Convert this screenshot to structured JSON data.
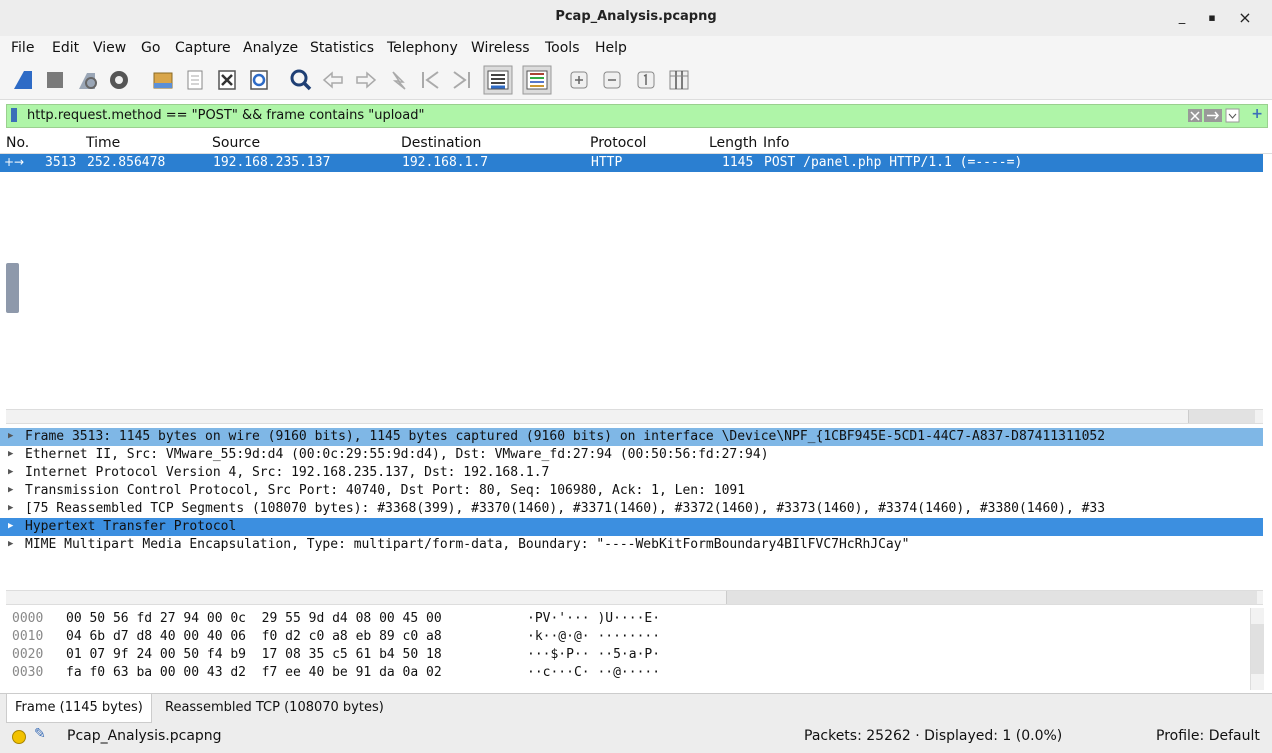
{
  "window": {
    "title": "Pcap_Analysis.pcapng",
    "minimize": "_",
    "maximize": "▪",
    "close": "×"
  },
  "menu": [
    "File",
    "Edit",
    "View",
    "Go",
    "Capture",
    "Analyze",
    "Statistics",
    "Telephony",
    "Wireless",
    "Tools",
    "Help"
  ],
  "filter": {
    "value": "http.request.method == \"POST\" && frame contains \"upload\""
  },
  "columns": [
    "No.",
    "Time",
    "Source",
    "Destination",
    "Protocol",
    "Length",
    "Info"
  ],
  "packet": {
    "no": "3513",
    "time": "252.856478",
    "source": "192.168.235.137",
    "destination": "192.168.1.7",
    "protocol": "HTTP",
    "length": "1145",
    "info": "POST /panel.php HTTP/1.1  (=----=)"
  },
  "details": [
    "Frame 3513: 1145 bytes on wire (9160 bits), 1145 bytes captured (9160 bits) on interface \\Device\\NPF_{1CBF945E-5CD1-44C7-A837-D87411311052",
    "Ethernet II, Src: VMware_55:9d:d4 (00:0c:29:55:9d:d4), Dst: VMware_fd:27:94 (00:50:56:fd:27:94)",
    "Internet Protocol Version 4, Src: 192.168.235.137, Dst: 192.168.1.7",
    "Transmission Control Protocol, Src Port: 40740, Dst Port: 80, Seq: 106980, Ack: 1, Len: 1091",
    "[75 Reassembled TCP Segments (108070 bytes): #3368(399), #3370(1460), #3371(1460), #3372(1460), #3373(1460), #3374(1460), #3380(1460), #33",
    "Hypertext Transfer Protocol",
    "MIME Multipart Media Encapsulation, Type: multipart/form-data, Boundary: \"----WebKitFormBoundary4BIlFVC7HcRhJCay\""
  ],
  "hex": [
    {
      "offset": "0000",
      "bytes": "00 50 56 fd 27 94 00 0c  29 55 9d d4 08 00 45 00",
      "ascii": "·PV·'··· )U····E·"
    },
    {
      "offset": "0010",
      "bytes": "04 6b d7 d8 40 00 40 06  f0 d2 c0 a8 eb 89 c0 a8",
      "ascii": "·k··@·@· ········"
    },
    {
      "offset": "0020",
      "bytes": "01 07 9f 24 00 50 f4 b9  17 08 35 c5 61 b4 50 18",
      "ascii": "···$·P·· ··5·a·P·"
    },
    {
      "offset": "0030",
      "bytes": "fa f0 63 ba 00 00 43 d2  f7 ee 40 be 91 da 0a 02",
      "ascii": "··c···C· ··@·····"
    }
  ],
  "tabs": [
    "Frame (1145 bytes)",
    "Reassembled TCP (108070 bytes)"
  ],
  "status": {
    "file": "Pcap_Analysis.pcapng",
    "packets": "Packets: 25262 · Displayed: 1 (0.0%)",
    "profile": "Profile: Default"
  },
  "colors": {
    "selected_row": "#2b7fd1",
    "filter_ok": "#aff5a8",
    "detail_selected": "#7fb7e6",
    "detail_highlight": "#3c8fe0"
  }
}
